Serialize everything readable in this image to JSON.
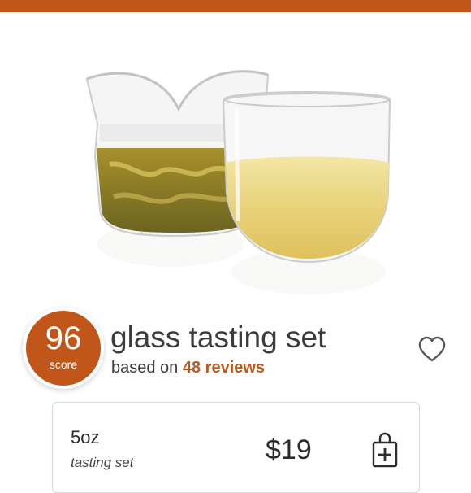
{
  "brand": {
    "accent": "#c0561a"
  },
  "product": {
    "image_icon": "glass-tasting-set-image",
    "score": "96",
    "score_label": "score",
    "title": "glass tasting set",
    "reviews_prefix": "based on ",
    "reviews_link": "48 reviews",
    "favorite_icon": "heart-outline-icon"
  },
  "options": [
    {
      "size": "5oz",
      "description": "tasting set",
      "price": "$19",
      "add_icon": "add-to-bag-icon"
    }
  ]
}
